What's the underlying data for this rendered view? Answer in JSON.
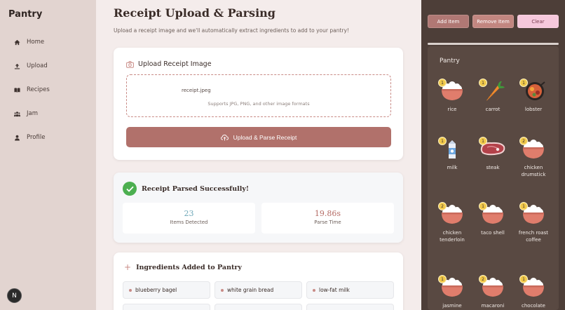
{
  "sidebar": {
    "brand": "Pantry",
    "items": [
      {
        "label": "Home",
        "icon": "home-icon"
      },
      {
        "label": "Upload",
        "icon": "upload-icon"
      },
      {
        "label": "Recipes",
        "icon": "book-icon"
      },
      {
        "label": "Jam",
        "icon": "people-icon"
      },
      {
        "label": "Profile",
        "icon": "person-icon"
      }
    ],
    "avatar_initial": "N"
  },
  "main": {
    "title": "Receipt Upload & Parsing",
    "subtitle": "Upload a receipt image and we'll automatically extract ingredients to add to your pantry!",
    "upload": {
      "heading": "Upload Receipt Image",
      "file_name": "receipt.jpeg",
      "hint": "Supports JPG, PNG, and other image formats",
      "button_label": "Upload & Parse Receipt"
    },
    "result": {
      "heading": "Receipt Parsed Successfully!",
      "stats": [
        {
          "value": "23",
          "label": "Items Detected",
          "color": "#6fa8b8"
        },
        {
          "value": "19.86s",
          "label": "Parse Time",
          "color": "#b56b65"
        }
      ]
    },
    "ingredients": {
      "heading": "Ingredients Added to Pantry",
      "items": [
        "blueberry bagel",
        "white grain bread",
        "low-fat milk"
      ]
    }
  },
  "panel": {
    "buttons": {
      "add": "Add Item",
      "remove": "Remove Item",
      "clear": "Clear"
    },
    "pantry_title": "Pantry",
    "items": [
      {
        "name": "rice",
        "count": "1",
        "icon": "rice-bowl-icon"
      },
      {
        "name": "carrot",
        "count": "1",
        "icon": "carrot-icon"
      },
      {
        "name": "lobster",
        "count": "1",
        "icon": "lobster-icon"
      },
      {
        "name": "milk",
        "count": "1",
        "icon": "milk-carton-icon"
      },
      {
        "name": "steak",
        "count": "1",
        "icon": "steak-icon"
      },
      {
        "name": "chicken drumstick",
        "count": "2",
        "icon": "rice-bowl-icon"
      },
      {
        "name": "chicken tenderloin",
        "count": "2",
        "icon": "rice-bowl-icon"
      },
      {
        "name": "taco shell",
        "count": "1",
        "icon": "rice-bowl-icon"
      },
      {
        "name": "french roast coffee",
        "count": "1",
        "icon": "rice-bowl-icon"
      },
      {
        "name": "jasmine",
        "count": "1",
        "icon": "rice-bowl-icon"
      },
      {
        "name": "macaroni",
        "count": "2",
        "icon": "rice-bowl-icon"
      },
      {
        "name": "chocolate",
        "count": "1",
        "icon": "rice-bowl-icon"
      }
    ]
  }
}
